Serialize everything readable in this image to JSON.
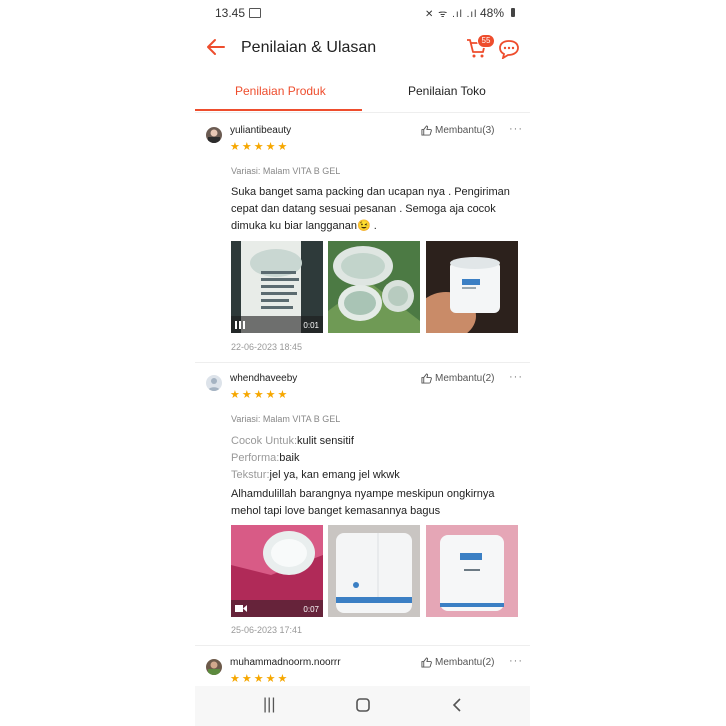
{
  "status": {
    "time": "13.45",
    "battery": "48%",
    "icons": "signal wifi"
  },
  "appbar": {
    "title": "Penilaian & Ulasan",
    "cart_badge": "55"
  },
  "tabs": [
    {
      "label": "Penilaian Produk"
    },
    {
      "label": "Penilaian Toko"
    }
  ],
  "reviews": [
    {
      "user": "yuliantibeauty",
      "helpful": "Membantu(3)",
      "stars": "★★★★★",
      "variant": "Variasi: Malam VITA B GEL",
      "body": "Suka banget sama packing dan ucapan nya . Pengiriman cepat dan datang sesuai pesanan . Semoga aja cocok dimuka ku biar langganan😉 .",
      "video_duration": "0:01",
      "date": "22-06-2023 18:45"
    },
    {
      "user": "whendhaveeby",
      "helpful": "Membantu(2)",
      "stars": "★★★★★",
      "variant": "Variasi: Malam VITA B GEL",
      "attrs": [
        {
          "k": "Cocok Untuk:",
          "v": "kulit sensitif"
        },
        {
          "k": "Performa:",
          "v": "baik"
        },
        {
          "k": "Tekstur:",
          "v": "jel ya, kan emang jel wkwk"
        }
      ],
      "body": "Alhamdulillah barangnya nyampe meskipun ongkirnya mehol tapi love banget kemasannya bagus",
      "video_duration": "0:07",
      "date": "25-06-2023 17:41"
    },
    {
      "user": "muhammadnoorm.noorrr",
      "helpful": "Membantu(2)",
      "stars": "★★★★★"
    }
  ],
  "colors": {
    "accent": "#ee4d2d",
    "star": "#f6a700"
  }
}
